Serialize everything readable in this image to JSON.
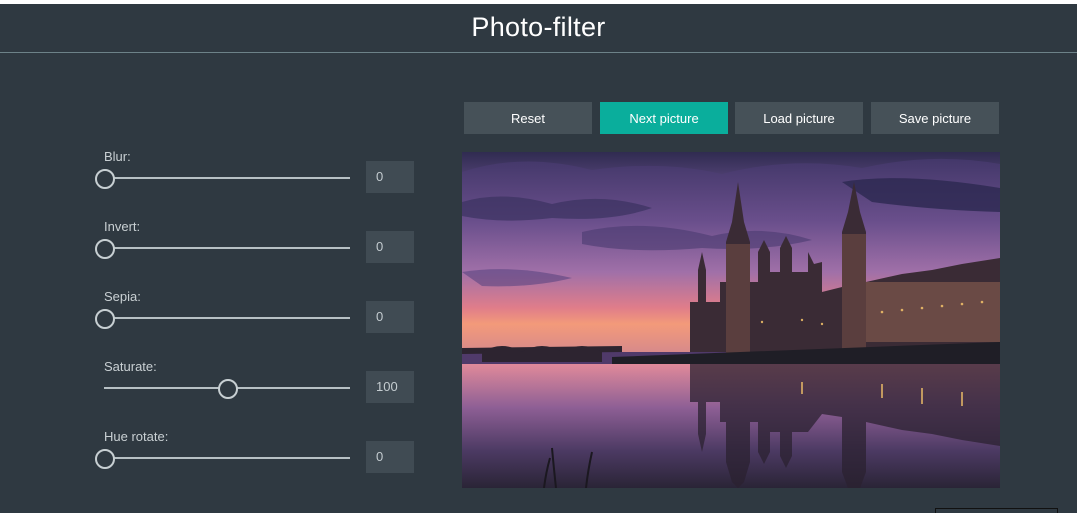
{
  "app": {
    "title": "Photo-filter"
  },
  "filters": [
    {
      "label": "Blur:",
      "value": "0",
      "level": 0
    },
    {
      "label": "Invert:",
      "value": "0",
      "level": 0
    },
    {
      "label": "Sepia:",
      "value": "0",
      "level": 0
    },
    {
      "label": "Saturate:",
      "value": "100",
      "level": 0.5
    },
    {
      "label": "Hue rotate:",
      "value": "0",
      "level": 0
    }
  ],
  "toolbar": {
    "reset_label": "Reset",
    "next_label": "Next picture",
    "load_label": "Load picture",
    "save_label": "Save picture"
  },
  "colors": {
    "background": "#2f3941",
    "button": "#465158",
    "accent": "#0aae9c",
    "value_box": "#404b53"
  }
}
